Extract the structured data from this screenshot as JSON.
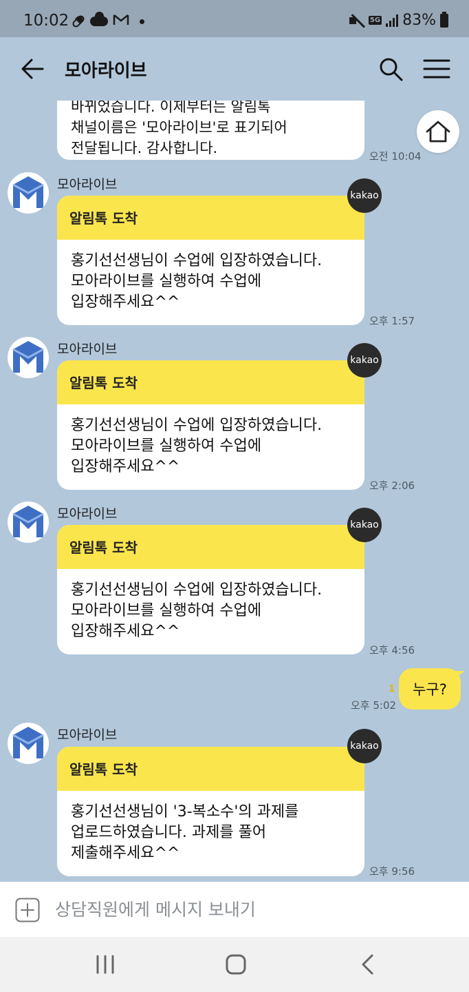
{
  "status_bar": {
    "time": "10:02",
    "icons": [
      "pill-icon",
      "cloud-icon",
      "gmail-icon",
      "dot-icon"
    ],
    "network": "5G",
    "battery": "83%"
  },
  "header": {
    "title": "모아라이브",
    "icons": [
      "back-arrow-icon",
      "search-icon",
      "menu-icon"
    ]
  },
  "messages": [
    {
      "type": "partial",
      "lines": [
        "바뀌었습니다. 이제부터는 알림톡",
        "채널이름은 '모아라이브'로 표기되어",
        "전달됩니다. 감사합니다."
      ],
      "time": "오전 10:04"
    },
    {
      "type": "alimtalk",
      "sender": "모아라이브",
      "badge": "kakao",
      "header": "알림톡 도착",
      "lines": [
        "홍기선선생님이 수업에 입장하였습니다.",
        "모아라이브를 실행하여 수업에",
        "입장해주세요^^"
      ],
      "time": "오후 1:57"
    },
    {
      "type": "alimtalk",
      "sender": "모아라이브",
      "badge": "kakao",
      "header": "알림톡 도착",
      "lines": [
        "홍기선선생님이 수업에 입장하였습니다.",
        "모아라이브를 실행하여 수업에",
        "입장해주세요^^"
      ],
      "time": "오후 2:06"
    },
    {
      "type": "alimtalk",
      "sender": "모아라이브",
      "badge": "kakao",
      "header": "알림톡 도착",
      "lines": [
        "홍기선선생님이 수업에 입장하였습니다.",
        "모아라이브를 실행하여 수업에",
        "입장해주세요^^"
      ],
      "time": "오후 4:56"
    },
    {
      "type": "mine",
      "text": "누구?",
      "unread": "1",
      "time": "오후 5:02"
    },
    {
      "type": "alimtalk",
      "sender": "모아라이브",
      "badge": "kakao",
      "header": "알림톡 도착",
      "lines": [
        "홍기선선생님이 '3-복소수'의 과제를",
        "업로드하였습니다. 과제를 풀어",
        "제출해주세요^^"
      ],
      "time": "오후 9:56"
    }
  ],
  "composer": {
    "placeholder": "상담직원에게 메시지 보내기",
    "value": ""
  },
  "colors": {
    "background": "#b2c7da",
    "bubble_yellow": "#fae54d",
    "status_bar": "#97a7b6",
    "avatar_logo": "#3f6fc4"
  }
}
